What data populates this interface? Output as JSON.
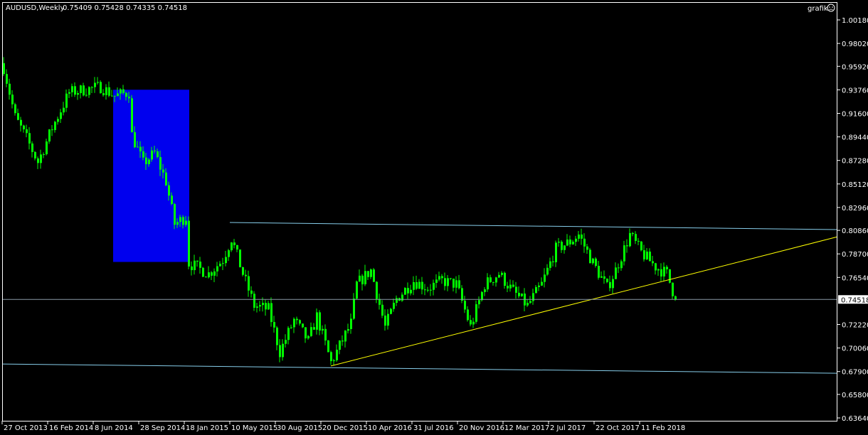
{
  "header": {
    "symbol": "AUDUSD,Weekly",
    "ohlc": "0.75409 0.75428 0.74335 0.74518"
  },
  "corner": {
    "label": "grafik",
    "icon": "sad-face-icon"
  },
  "colors": {
    "background": "#000000",
    "candle": "#00ff00",
    "trend_blue": "#87ceeb",
    "trend_yellow": "#ffff00",
    "rect": "#0000ee",
    "price_line": "#8a9aa6"
  },
  "chart_data": {
    "type": "candlestick",
    "title": "AUDUSD,Weekly",
    "ylim": [
      0.6364,
      1.0018
    ],
    "weeks_total": 293.5,
    "current_price": "0.74518",
    "y_ticks": [
      "1.00180",
      "0.98020",
      "0.95920",
      "0.93760",
      "0.91600",
      "0.89440",
      "0.87280",
      "0.85120",
      "0.82960",
      "0.80860",
      "0.78700",
      "0.76540",
      "0.72220",
      "0.70060",
      "0.67900",
      "0.65800",
      "0.63640"
    ],
    "x_ticks": [
      {
        "week": 0,
        "label": "27 Oct 2013"
      },
      {
        "week": 16,
        "label": "16 Feb 2014"
      },
      {
        "week": 32,
        "label": "8 Jun 2014"
      },
      {
        "week": 48,
        "label": "28 Sep 2014"
      },
      {
        "week": 64,
        "label": "18 Jan 2015"
      },
      {
        "week": 80,
        "label": "10 May 2015"
      },
      {
        "week": 96,
        "label": "30 Aug 2015"
      },
      {
        "week": 112,
        "label": "20 Dec 2015"
      },
      {
        "week": 128,
        "label": "10 Apr 2016"
      },
      {
        "week": 144,
        "label": "31 Jul 2016"
      },
      {
        "week": 160,
        "label": "20 Nov 2016"
      },
      {
        "week": 176,
        "label": "12 Mar 2017"
      },
      {
        "week": 192,
        "label": "2 Jul 2017"
      },
      {
        "week": 208,
        "label": "22 Oct 2017"
      },
      {
        "week": 224,
        "label": "11 Feb 2018"
      }
    ],
    "close_anchors": [
      [
        0,
        0.9581
      ],
      [
        4,
        0.9124
      ],
      [
        8,
        0.8928
      ],
      [
        12,
        0.8713
      ],
      [
        17,
        0.9026
      ],
      [
        23,
        0.9352
      ],
      [
        34,
        0.9404
      ],
      [
        39,
        0.932
      ],
      [
        44,
        0.9352
      ],
      [
        45,
        0.8961
      ],
      [
        49,
        0.87
      ],
      [
        53,
        0.8797
      ],
      [
        57,
        0.8536
      ],
      [
        60,
        0.8144
      ],
      [
        64,
        0.821
      ],
      [
        65,
        0.7786
      ],
      [
        72,
        0.7688
      ],
      [
        77,
        0.7818
      ],
      [
        80,
        0.8014
      ],
      [
        84,
        0.7688
      ],
      [
        88,
        0.7394
      ],
      [
        93,
        0.7361
      ],
      [
        97,
        0.697
      ],
      [
        102,
        0.7263
      ],
      [
        107,
        0.7068
      ],
      [
        110,
        0.7296
      ],
      [
        115,
        0.6872
      ],
      [
        122,
        0.7231
      ],
      [
        124,
        0.759
      ],
      [
        129,
        0.772
      ],
      [
        134,
        0.7198
      ],
      [
        138,
        0.7459
      ],
      [
        144,
        0.7622
      ],
      [
        149,
        0.7557
      ],
      [
        154,
        0.7622
      ],
      [
        159,
        0.759
      ],
      [
        164,
        0.7198
      ],
      [
        169,
        0.759
      ],
      [
        174,
        0.7688
      ],
      [
        179,
        0.7524
      ],
      [
        184,
        0.7394
      ],
      [
        189,
        0.759
      ],
      [
        194,
        0.7916
      ],
      [
        199,
        0.7981
      ],
      [
        202,
        0.8047
      ],
      [
        207,
        0.7786
      ],
      [
        212,
        0.7557
      ],
      [
        215,
        0.772
      ],
      [
        220,
        0.8047
      ],
      [
        224,
        0.7884
      ],
      [
        229,
        0.7753
      ],
      [
        233,
        0.7688
      ],
      [
        236,
        0.7452
      ]
    ],
    "trendlines": [
      {
        "name": "upper-channel",
        "color": "#87ceeb",
        "from": [
          80,
          0.8158
        ],
        "to": [
          293.5,
          0.8093
        ]
      },
      {
        "name": "lower-channel",
        "color": "#87ceeb",
        "from": [
          0,
          0.6859
        ],
        "to": [
          293.5,
          0.6774
        ]
      },
      {
        "name": "support-trend",
        "color": "#ffff00",
        "from": [
          115.5,
          0.6841
        ],
        "to": [
          293.5,
          0.8027
        ]
      }
    ],
    "rectangle": {
      "from": [
        39,
        0.9377
      ],
      "to": [
        65.75,
        0.7796
      ],
      "color": "#0000ee"
    }
  }
}
